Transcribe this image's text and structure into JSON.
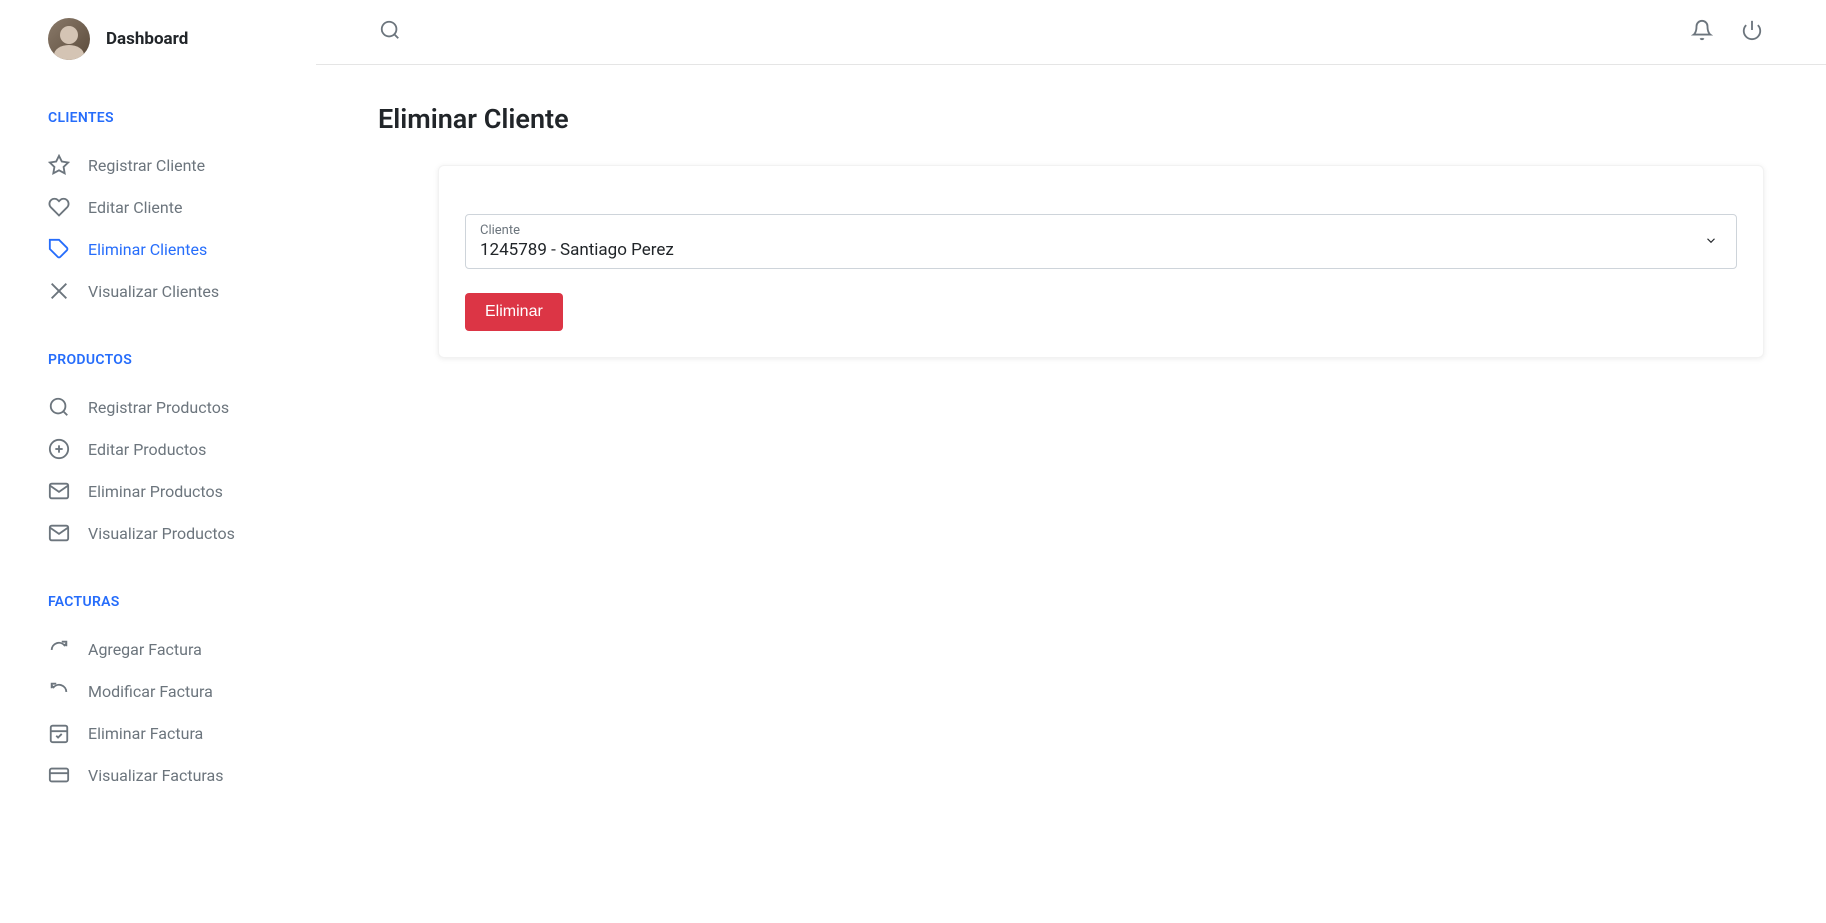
{
  "sidebar": {
    "title": "Dashboard",
    "sections": [
      {
        "heading": "CLIENTES",
        "items": [
          {
            "label": "Registrar Cliente",
            "icon": "star-icon",
            "active": false
          },
          {
            "label": "Editar Cliente",
            "icon": "heart-icon",
            "active": false
          },
          {
            "label": "Eliminar Clientes",
            "icon": "tag-icon",
            "active": true
          },
          {
            "label": "Visualizar Clientes",
            "icon": "shuffle-icon",
            "active": false
          }
        ]
      },
      {
        "heading": "PRODUCTOS",
        "items": [
          {
            "label": "Registrar Productos",
            "icon": "search-icon",
            "active": false
          },
          {
            "label": "Editar Productos",
            "icon": "plus-circle-icon",
            "active": false
          },
          {
            "label": "Eliminar Productos",
            "icon": "mail-icon",
            "active": false
          },
          {
            "label": "Visualizar Productos",
            "icon": "mail-icon",
            "active": false
          }
        ]
      },
      {
        "heading": "FACTURAS",
        "items": [
          {
            "label": "Agregar Factura",
            "icon": "redo-icon",
            "active": false
          },
          {
            "label": "Modificar Factura",
            "icon": "undo-icon",
            "active": false
          },
          {
            "label": "Eliminar Factura",
            "icon": "calendar-check-icon",
            "active": false
          },
          {
            "label": "Visualizar Facturas",
            "icon": "card-icon",
            "active": false
          }
        ]
      }
    ]
  },
  "page": {
    "title": "Eliminar Cliente",
    "select": {
      "label": "Cliente",
      "value": "1245789 - Santiago Perez"
    },
    "button": "Eliminar"
  }
}
